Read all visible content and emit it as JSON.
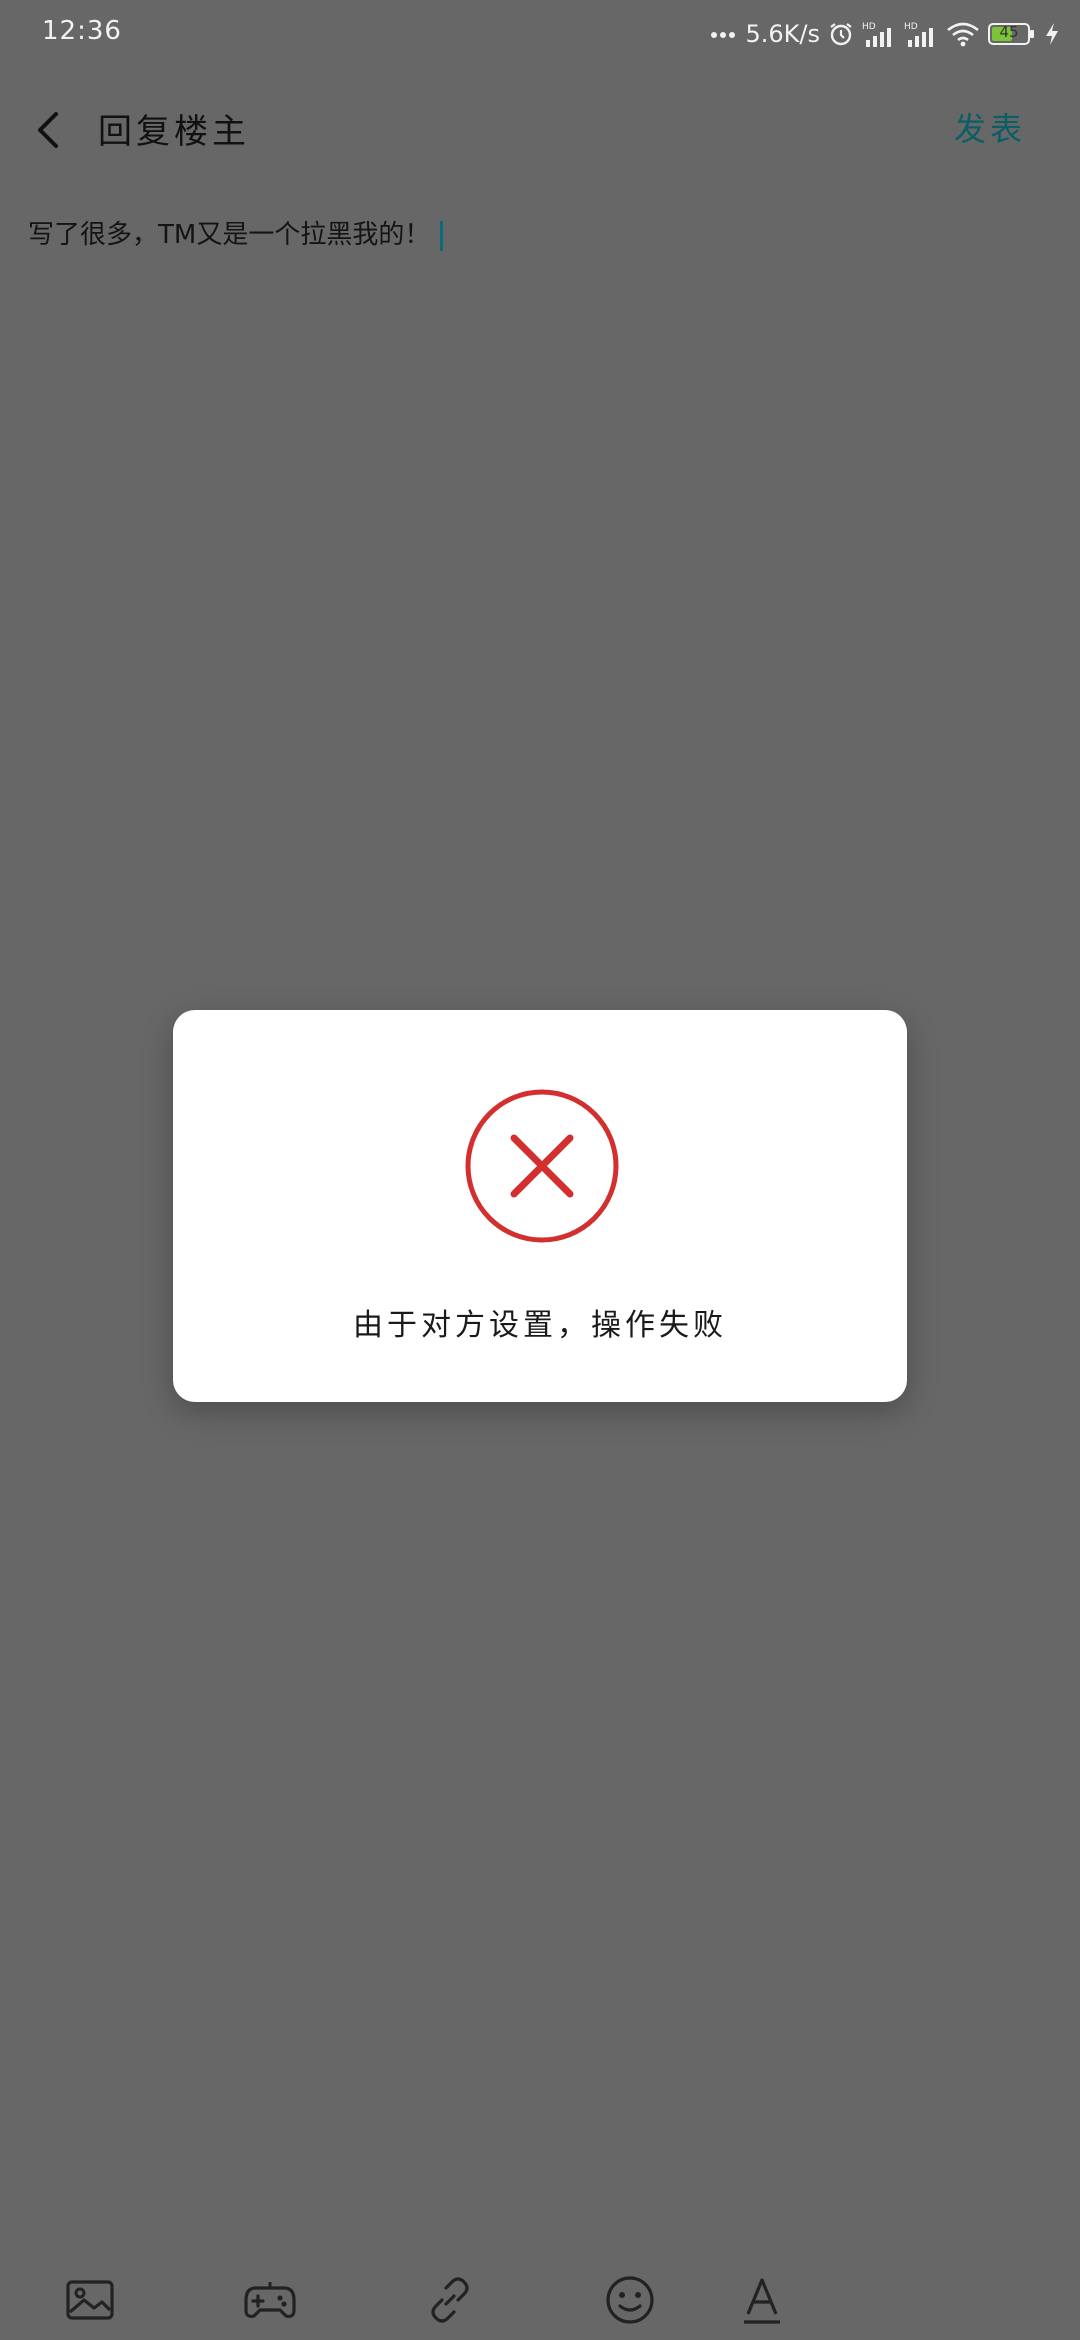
{
  "status_bar": {
    "time": "12:36",
    "network_speed": "5.6K/s",
    "battery_level": "45",
    "icons": [
      "more-dots-icon",
      "alarm-icon",
      "signal-hd-icon",
      "signal-hd-icon",
      "wifi-icon",
      "battery-icon",
      "charging-icon"
    ]
  },
  "header": {
    "back_icon": "back-arrow-icon",
    "title": "回复楼主",
    "publish_label": "发表"
  },
  "editor": {
    "content": "写了很多，TM又是一个拉黑我的！"
  },
  "dialog": {
    "icon": "error-circle-x-icon",
    "message": "由于对方设置，操作失败"
  },
  "toolbar": {
    "items": [
      "image-icon",
      "game-controller-icon",
      "link-icon",
      "emoji-icon",
      "text-format-icon"
    ]
  },
  "colors": {
    "overlay_background": "#676767",
    "accent": "#0b5e66",
    "error": "#d32f2f",
    "dialog_background": "#ffffff"
  }
}
